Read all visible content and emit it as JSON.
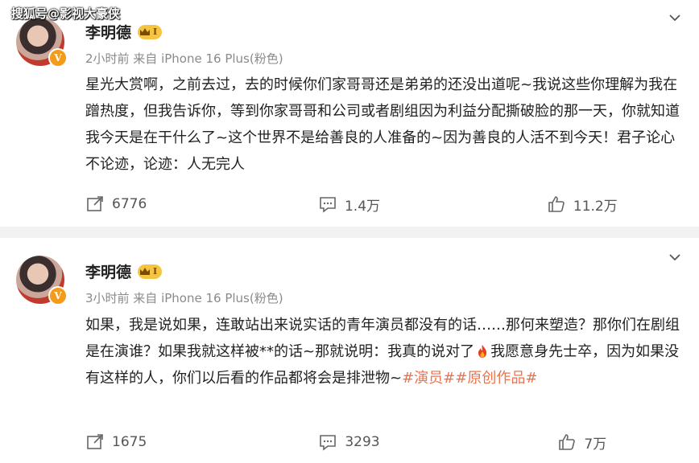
{
  "watermark": "搜狐号@影视大豪侠",
  "posts": [
    {
      "author": "李明德",
      "level": "I",
      "verified_badge": "V",
      "meta": "2小时前 来自 iPhone 16 Plus(粉色)",
      "text_plain": "星光大赏啊，之前去过，去的时候你们家哥哥还是弟弟的还没出道呢~我说这些你理解为我在蹭热度，但我告诉你，等到你家哥哥和公司或者剧组因为利益分配撕破脸的那一天，你就知道我今天是在干什么了~这个世界不是给善良的人准备的~因为善良的人活不到今天！君子论心不论迹，论迹：人无完人",
      "reposts": "6776",
      "comments": "1.4万",
      "likes": "11.2万"
    },
    {
      "author": "李明德",
      "level": "I",
      "verified_badge": "V",
      "meta": "3小时前 来自 iPhone 16 Plus(粉色)",
      "text_part1": "如果，我是说如果，连敢站出来说实话的青年演员都没有的话……那何来塑造？那你们在剧组是在演谁？如果我就这样被**的话~那就说明：我真的说对了",
      "text_part2": "我愿意身先士卒，因为如果没有这样的人，你们以后看的作品都将会是排泄物~",
      "tag1": "#演员#",
      "tag2": "#原创作品#",
      "reposts": "1675",
      "comments": "3293",
      "likes": "7万"
    }
  ],
  "icons": {
    "repost": "repost-icon",
    "comment": "comment-icon",
    "like": "like-icon",
    "more": "chevron-down-icon",
    "emoji": "fire-emoji-icon"
  },
  "colors": {
    "tag": "#eb7350",
    "badge": "#f39b1c",
    "level": "#f5c542",
    "divider": "#f2f2f2"
  }
}
